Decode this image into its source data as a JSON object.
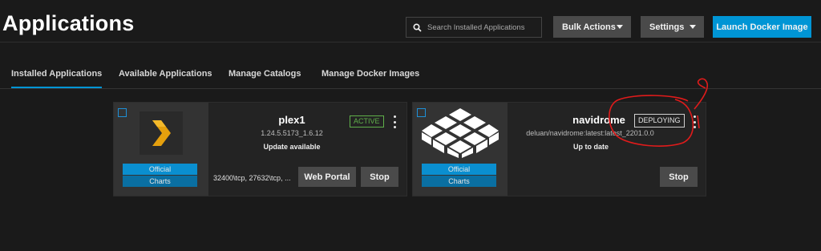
{
  "header": {
    "title": "Applications",
    "search": {
      "placeholder": "Search Installed Applications",
      "value": ""
    },
    "bulk_actions_label": "Bulk Actions",
    "settings_label": "Settings",
    "launch_label": "Launch Docker Image"
  },
  "tabs": [
    {
      "label": "Installed Applications",
      "active": true
    },
    {
      "label": "Available Applications",
      "active": false
    },
    {
      "label": "Manage Catalogs",
      "active": false
    },
    {
      "label": "Manage Docker Images",
      "active": false
    }
  ],
  "apps": [
    {
      "name": "plex1",
      "version": "1.24.5.5173_1.6.12",
      "update_status": "Update available",
      "status": "ACTIVE",
      "catalog_top": "Official",
      "catalog_bottom": "Charts",
      "ports": "32400\\tcp, 27632\\tcp, ...",
      "web_portal_label": "Web Portal",
      "stop_label": "Stop",
      "icon": "plex-chevron-logo"
    },
    {
      "name": "navidrome",
      "version": "deluan/navidrome:latest:latest_2201.0.0",
      "update_status": "Up to date",
      "status": "DEPLOYING",
      "catalog_top": "Official",
      "catalog_bottom": "Charts",
      "stop_label": "Stop",
      "icon": "navidrome-cube-logo"
    }
  ],
  "colors": {
    "accent": "#0095d5",
    "active_green": "#5fb04a",
    "annotation_red": "#e01b1b",
    "background": "#1a1a1a",
    "card": "#232323"
  }
}
